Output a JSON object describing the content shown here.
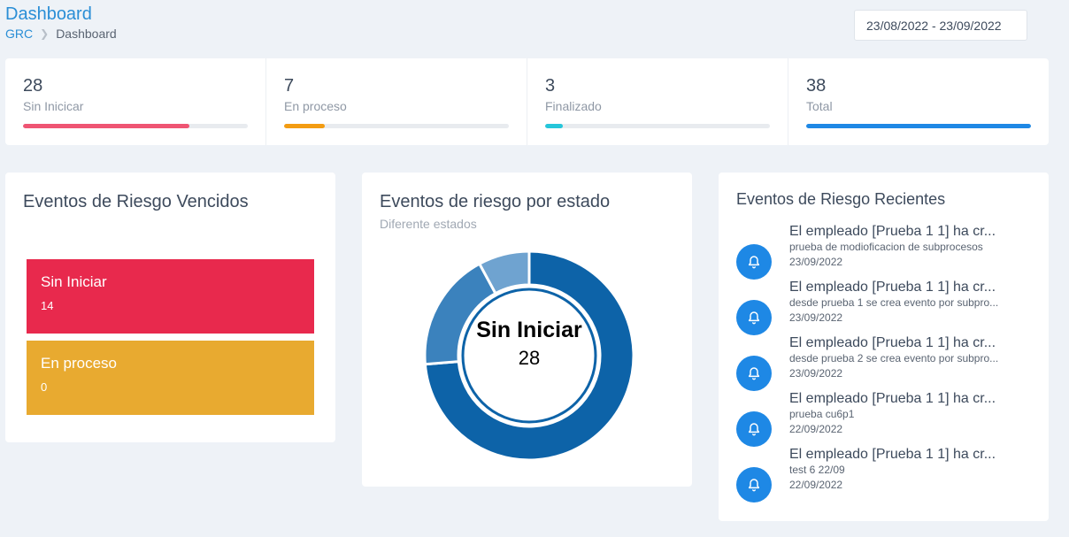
{
  "header": {
    "title": "Dashboard",
    "breadcrumb": {
      "root": "GRC",
      "current": "Dashboard"
    },
    "date_range": "23/08/2022 - 23/09/2022"
  },
  "stats": [
    {
      "value": "28",
      "label": "Sin Inicicar",
      "progress": 0.74,
      "color": "#ef5573"
    },
    {
      "value": "7",
      "label": "En proceso",
      "progress": 0.18,
      "color": "#f39c12"
    },
    {
      "value": "3",
      "label": "Finalizado",
      "progress": 0.08,
      "color": "#26c6da"
    },
    {
      "value": "38",
      "label": "Total",
      "progress": 1.0,
      "color": "#1e88e5"
    }
  ],
  "vencidos": {
    "title": "Eventos de Riesgo Vencidos",
    "items": [
      {
        "label": "Sin Iniciar",
        "count": "14",
        "color": "#e8294d"
      },
      {
        "label": "En proceso",
        "count": "0",
        "color": "#e8aa30"
      }
    ]
  },
  "estado": {
    "title": "Eventos de riesgo por estado",
    "subtitle": "Diferente estados",
    "center_label": "Sin Iniciar",
    "center_value": "28"
  },
  "chart_data": {
    "type": "pie",
    "categories": [
      "Sin Iniciar",
      "En proceso",
      "Finalizado"
    ],
    "values": [
      28,
      7,
      3
    ],
    "colors": [
      "#0d63a8",
      "#3b82bd",
      "#6fa3d0"
    ]
  },
  "recent": {
    "title": "Eventos de Riesgo Recientes",
    "items": [
      {
        "title": "El empleado [Prueba 1 1] ha cr...",
        "desc": "prueba de modioficacion de subprocesos",
        "date": "23/09/2022",
        "icon": "bell-icon"
      },
      {
        "title": "El empleado [Prueba 1 1] ha cr...",
        "desc": "desde prueba 1 se crea evento por subpro...",
        "date": "23/09/2022",
        "icon": "bell-icon"
      },
      {
        "title": "El empleado [Prueba 1 1] ha cr...",
        "desc": "desde prueba 2 se crea evento por subpro...",
        "date": "23/09/2022",
        "icon": "bell-icon"
      },
      {
        "title": "El empleado [Prueba 1 1] ha cr...",
        "desc": "prueba cu6p1",
        "date": "22/09/2022",
        "icon": "bell-icon"
      },
      {
        "title": "El empleado [Prueba 1 1] ha cr...",
        "desc": "test 6 22/09",
        "date": "22/09/2022",
        "icon": "bell-icon"
      }
    ]
  }
}
